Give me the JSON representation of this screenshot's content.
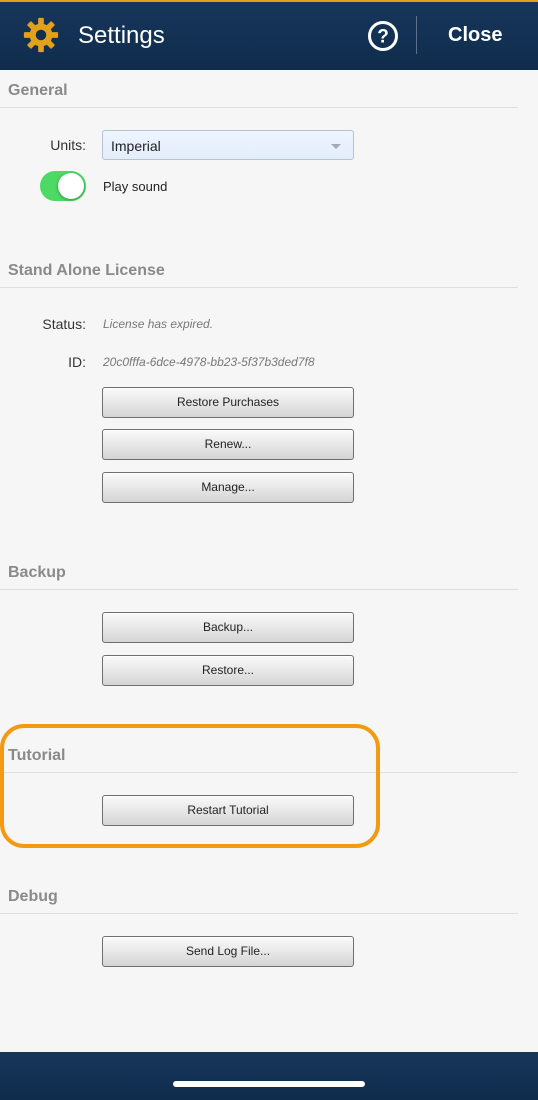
{
  "header": {
    "title": "Settings",
    "close_label": "Close",
    "help_icon_glyph": "?"
  },
  "general": {
    "title": "General",
    "units_label": "Units:",
    "units_value": "Imperial",
    "play_sound_label": "Play sound",
    "play_sound_on": true
  },
  "license": {
    "title": "Stand Alone License",
    "status_label": "Status:",
    "status_value": "License has expired.",
    "id_label": "ID:",
    "id_value": "20c0fffa-6dce-4978-bb23-5f37b3ded7f8",
    "buttons": [
      "Restore Purchases",
      "Renew...",
      "Manage..."
    ]
  },
  "backup": {
    "title": "Backup",
    "buttons": [
      "Backup...",
      "Restore..."
    ]
  },
  "tutorial": {
    "title": "Tutorial",
    "restart_label": "Restart Tutorial"
  },
  "debug": {
    "title": "Debug",
    "send_log_label": "Send Log File..."
  },
  "colors": {
    "header_bg": "#0f2c4c",
    "accent_gear": "#e2a11b",
    "highlight": "#f39a12",
    "toggle_on": "#4cd964"
  }
}
